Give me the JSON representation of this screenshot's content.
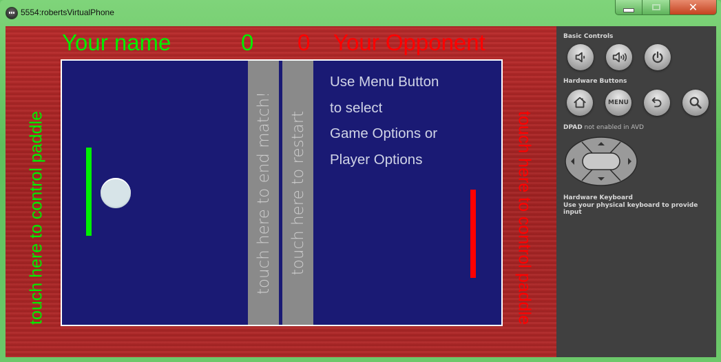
{
  "window": {
    "title": "5554:robertsVirtualPhone",
    "buttons": {
      "minimize": "minimize",
      "maximize": "maximize",
      "close": "close"
    }
  },
  "game": {
    "player_name": "Your name",
    "player_score": "0",
    "opponent_score": "0",
    "opponent_name": "Your Opponent",
    "left_hint": "touch here to control paddle",
    "right_hint": "touch here to control paddle",
    "end_match": "touch here to end match!",
    "restart": "touch here to restart",
    "instructions": [
      "Use Menu Button",
      "to select",
      "Game Options or",
      "Player Options"
    ],
    "colors": {
      "player": "#00ee00",
      "opponent": "#ff0000",
      "court": "#1a1a74",
      "strip": "#8a8a8a"
    }
  },
  "controls": {
    "basic_label": "Basic Controls",
    "basic_buttons": [
      "volume-down",
      "volume-up",
      "power"
    ],
    "hardware_label": "Hardware Buttons",
    "hardware_buttons": [
      "home",
      "MENU",
      "back",
      "search"
    ],
    "menu_label": "MENU",
    "dpad_label_bold": "DPAD",
    "dpad_label_rest": " not enabled in AVD",
    "keyboard_title": "Hardware Keyboard",
    "keyboard_desc": "Use your physical keyboard to provide input"
  }
}
